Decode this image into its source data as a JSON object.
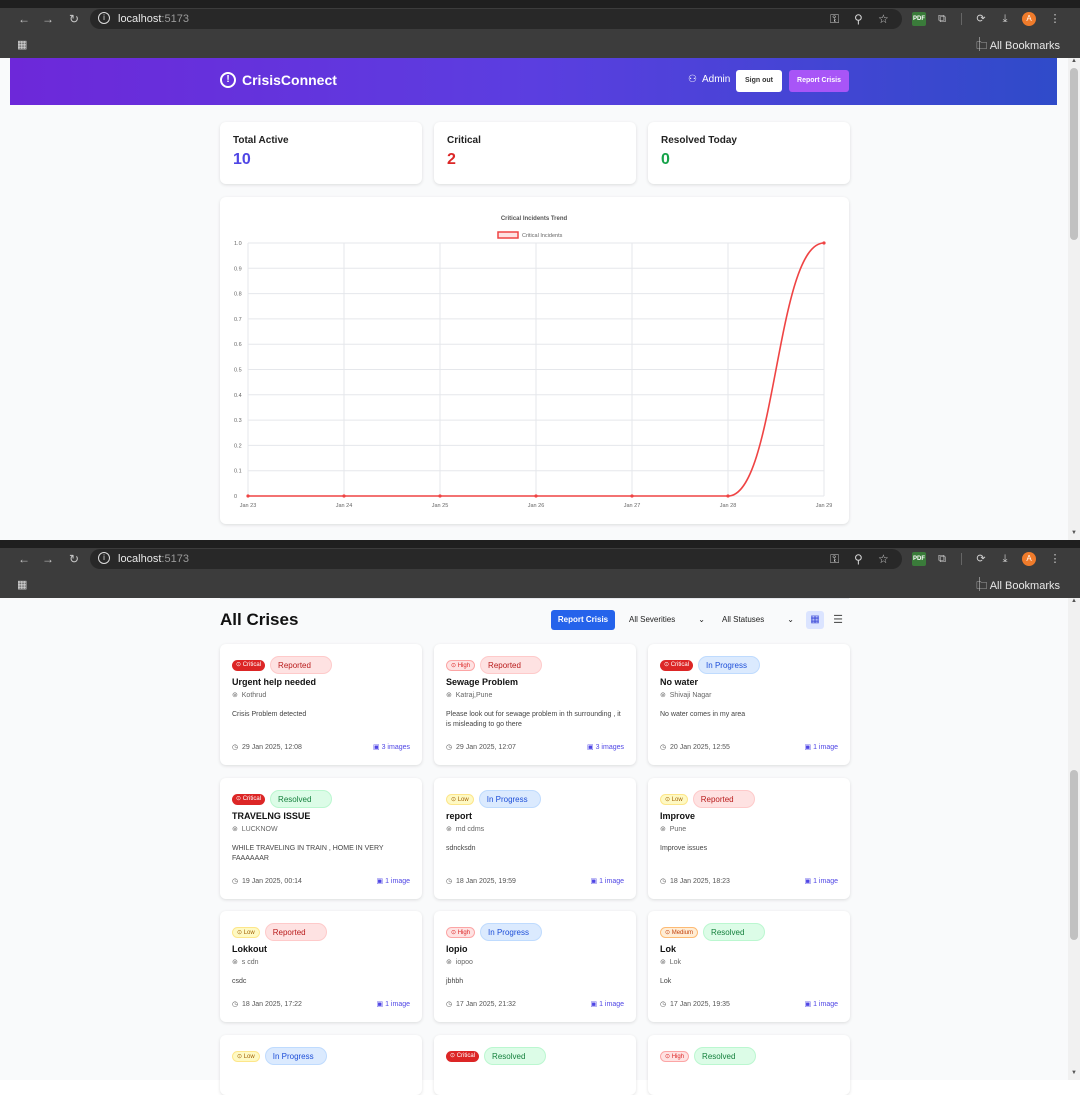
{
  "browser": {
    "url_host": "localhost",
    "url_port": ":5173",
    "all_bookmarks": "All Bookmarks",
    "profile_initial": "A",
    "pdf_label": "PDF"
  },
  "header": {
    "app_name": "CrisisConnect",
    "user": "Admin",
    "sign_out": "Sign out",
    "report_crisis": "Report Crisis"
  },
  "stats": [
    {
      "label": "Total Active",
      "value": "10",
      "color": "#4f46e5"
    },
    {
      "label": "Critical",
      "value": "2",
      "color": "#dc2626"
    },
    {
      "label": "Resolved Today",
      "value": "0",
      "color": "#16a34a"
    }
  ],
  "chart_data": {
    "type": "line",
    "title": "Critical Incidents Trend",
    "x": [
      "Jan 23",
      "Jan 24",
      "Jan 25",
      "Jan 26",
      "Jan 27",
      "Jan 28",
      "Jan 29"
    ],
    "series": [
      {
        "name": "Critical Incidents",
        "values": [
          0,
          0,
          0,
          0,
          0,
          0,
          1
        ],
        "color": "#ef4444"
      }
    ],
    "ylim": [
      0,
      1
    ],
    "yticks": [
      "0",
      "0.1",
      "0.2",
      "0.3",
      "0.4",
      "0.5",
      "0.6",
      "0.7",
      "0.8",
      "0.9",
      "1.0"
    ],
    "grid": true,
    "legend": "top-center"
  },
  "crises": {
    "title": "All Crises",
    "report_button": "Report Crisis",
    "severity_filter": "All Severities",
    "status_filter": "All Statuses",
    "items": [
      {
        "severity": "Critical",
        "sev_class": "critical",
        "status": "Reported",
        "status_class": "reported",
        "title": "Urgent help needed",
        "location": "Kothrud",
        "desc": "Crisis Problem detected",
        "date": "29 Jan 2025, 12:08",
        "images": "3 images"
      },
      {
        "severity": "High",
        "sev_class": "high",
        "status": "Reported",
        "status_class": "reported",
        "title": "Sewage Problem",
        "location": "Katraj,Pune",
        "desc": "Please look out for sewage problem in th surrounding , it is misleading to go there",
        "date": "29 Jan 2025, 12:07",
        "images": "3 images"
      },
      {
        "severity": "Critical",
        "sev_class": "critical",
        "status": "In Progress",
        "status_class": "inprogress",
        "title": "No water",
        "location": "Shivaji Nagar",
        "desc": "No water comes in my area",
        "date": "20 Jan 2025, 12:55",
        "images": "1 image"
      },
      {
        "severity": "Critical",
        "sev_class": "critical",
        "status": "Resolved",
        "status_class": "resolved",
        "title": "TRAVELNG ISSUE",
        "location": "LUCKNOW",
        "desc": "WHILE TRAVELING IN TRAIN , HOME IN VERY FAAAAAAR",
        "date": "19 Jan 2025, 00:14",
        "images": "1 image"
      },
      {
        "severity": "Low",
        "sev_class": "low",
        "status": "In Progress",
        "status_class": "inprogress",
        "title": "report",
        "location": "md cdms",
        "desc": "sdncksdn",
        "date": "18 Jan 2025, 19:59",
        "images": "1 image"
      },
      {
        "severity": "Low",
        "sev_class": "low",
        "status": "Reported",
        "status_class": "reported",
        "title": "Improve",
        "location": "Pune",
        "desc": "Improve issues",
        "date": "18 Jan 2025, 18:23",
        "images": "1 image"
      },
      {
        "severity": "Low",
        "sev_class": "low",
        "status": "Reported",
        "status_class": "reported",
        "title": "Lokkout",
        "location": "s cdn",
        "desc": "csdc",
        "date": "18 Jan 2025, 17:22",
        "images": "1 image"
      },
      {
        "severity": "High",
        "sev_class": "high",
        "status": "In Progress",
        "status_class": "inprogress",
        "title": "lopio",
        "location": "iopoo",
        "desc": "jbhbh",
        "date": "17 Jan 2025, 21:32",
        "images": "1 image"
      },
      {
        "severity": "Medium",
        "sev_class": "medium",
        "status": "Resolved",
        "status_class": "resolved",
        "title": "Lok",
        "location": "Lok",
        "desc": "Lok",
        "date": "17 Jan 2025, 19:35",
        "images": "1 image"
      },
      {
        "severity": "Low",
        "sev_class": "low",
        "status": "In Progress",
        "status_class": "inprogress",
        "title": "",
        "location": "",
        "desc": "",
        "date": "",
        "images": ""
      },
      {
        "severity": "Critical",
        "sev_class": "critical",
        "status": "Resolved",
        "status_class": "resolved",
        "title": "",
        "location": "",
        "desc": "",
        "date": "",
        "images": ""
      },
      {
        "severity": "High",
        "sev_class": "high",
        "status": "Resolved",
        "status_class": "resolved",
        "title": "",
        "location": "",
        "desc": "",
        "date": "",
        "images": ""
      }
    ]
  }
}
